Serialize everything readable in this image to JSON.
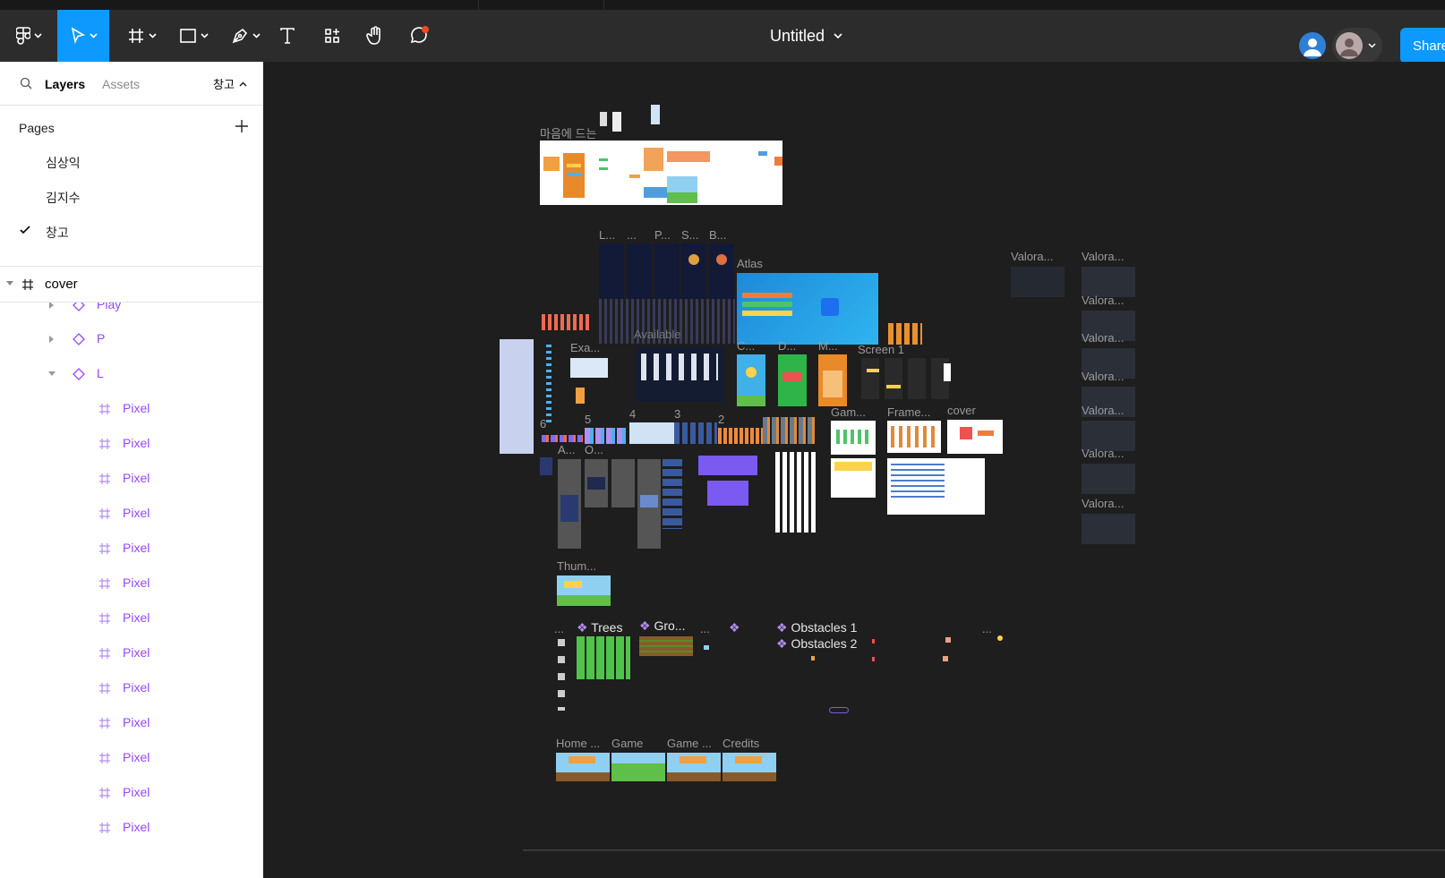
{
  "toolbar": {
    "title": "Untitled",
    "share_label": "Share"
  },
  "panel": {
    "tabs": {
      "layers": "Layers",
      "assets": "Assets",
      "current_page": "창고"
    },
    "pages_header": "Pages",
    "pages": [
      {
        "label": "심상익",
        "selected": false
      },
      {
        "label": "김지수",
        "selected": false
      },
      {
        "label": "창고",
        "selected": true
      }
    ],
    "cover_frame": "cover",
    "layers": [
      {
        "label": "Play",
        "kind": "component",
        "expanded": false
      },
      {
        "label": "P",
        "kind": "component",
        "expanded": false
      },
      {
        "label": "L",
        "kind": "component",
        "expanded": true
      },
      {
        "label": "Pixel",
        "kind": "frame"
      },
      {
        "label": "Pixel",
        "kind": "frame"
      },
      {
        "label": "Pixel",
        "kind": "frame"
      },
      {
        "label": "Pixel",
        "kind": "frame"
      },
      {
        "label": "Pixel",
        "kind": "frame"
      },
      {
        "label": "Pixel",
        "kind": "frame"
      },
      {
        "label": "Pixel",
        "kind": "frame"
      },
      {
        "label": "Pixel",
        "kind": "frame"
      },
      {
        "label": "Pixel",
        "kind": "frame"
      },
      {
        "label": "Pixel",
        "kind": "frame"
      },
      {
        "label": "Pixel",
        "kind": "frame"
      },
      {
        "label": "Pixel",
        "kind": "frame"
      },
      {
        "label": "Pixel",
        "kind": "frame"
      }
    ]
  },
  "canvas": {
    "frame_labels": {
      "maeum": "마음에 드는",
      "l": "L...",
      "dots1": "...",
      "p": "P...",
      "s": "S...",
      "b": "B...",
      "atlas": "Atlas",
      "exa": "Exa...",
      "available": "Available",
      "c": "C...",
      "d": "D...",
      "m": "M...",
      "screen1": "Screen 1",
      "n6": "6",
      "n5": "5",
      "n4": "4",
      "n3": "3",
      "n2": "2",
      "gam": "Gam...",
      "frame": "Frame...",
      "cover": "cover",
      "a": "A...",
      "o": "O...",
      "thum": "Thum...",
      "home": "Home ...",
      "game": "Game",
      "game2": "Game ...",
      "credits": "Credits",
      "valora": "Valora..."
    },
    "component_labels": {
      "trees": "Trees",
      "gro": "Gro...",
      "obstacles1": "Obstacles 1",
      "obstacles2": "Obstacles 2"
    },
    "colors": {
      "accent": "#0d99ff",
      "component": "#9747ff",
      "canvas_bg": "#1e1e1e",
      "toolbar_bg": "#2c2c2c"
    }
  }
}
